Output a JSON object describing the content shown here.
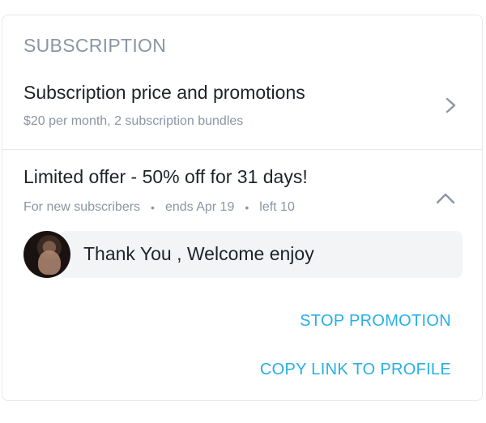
{
  "section": {
    "header": "SUBSCRIPTION"
  },
  "price_row": {
    "title": "Subscription price and promotions",
    "subtitle": "$20 per month, 2 subscription bundles",
    "icon": "chevron-right-icon"
  },
  "offer": {
    "title": "Limited offer - 50% off for 31 days!",
    "audience": "For new subscribers",
    "ends": "ends Apr 19",
    "left": "left 10",
    "separator": "•",
    "icon": "chevron-up-icon"
  },
  "message": {
    "text": "Thank You , Welcome enjoy",
    "avatar": "avatar"
  },
  "actions": {
    "stop_promotion": "STOP PROMOTION",
    "copy_link": "COPY LINK TO PROFILE"
  },
  "colors": {
    "accent": "#27b0e6",
    "muted_text": "#8a96a3",
    "primary_text": "#1f2329",
    "divider": "#e6e8eb",
    "bubble": "#f2f4f6"
  }
}
